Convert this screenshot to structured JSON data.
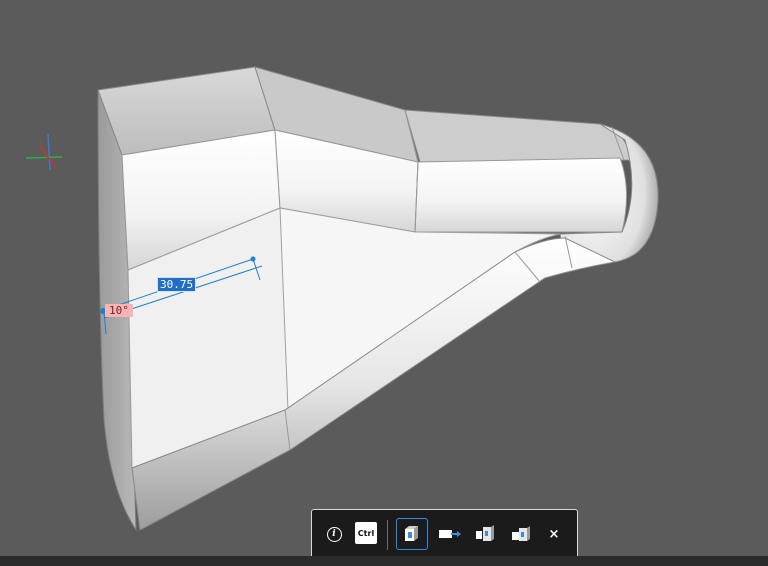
{
  "dimensions": {
    "length_value": "30.75",
    "angle_value": "10°"
  },
  "toolbar": {
    "ctrl_key_label": "Ctrl",
    "close_symbol": "×",
    "items": [
      {
        "name": "info",
        "icon": "info-icon"
      },
      {
        "name": "ctrl",
        "icon": "ctrl-key-icon"
      },
      {
        "name": "extrude-face",
        "icon": "extrude-face-icon",
        "selected": true
      },
      {
        "name": "extrude-direction",
        "icon": "extrude-arrow-icon"
      },
      {
        "name": "extrude-both",
        "icon": "extrude-both-icon"
      },
      {
        "name": "extrude-merge",
        "icon": "extrude-merge-icon"
      },
      {
        "name": "close",
        "icon": "close-icon"
      }
    ]
  },
  "colors": {
    "background": "#5b5b5b",
    "accent": "#1f6fc9",
    "angle_badge": "#f7b4b4",
    "toolbar_bg": "#1b1b1b"
  }
}
